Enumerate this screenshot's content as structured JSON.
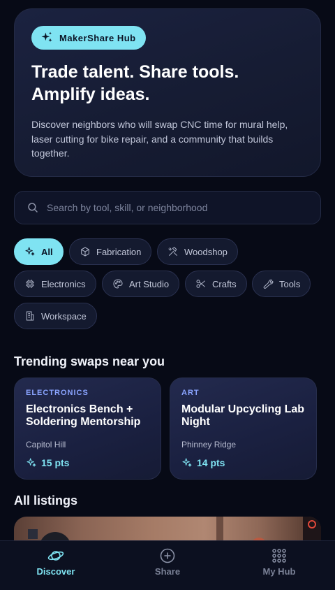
{
  "hero": {
    "brand": "MakerShare Hub",
    "title": "Trade talent. Share tools. Amplify ideas.",
    "description": "Discover neighbors who will swap CNC time for mural help, laser cutting for bike repair, and a community that builds together."
  },
  "search": {
    "placeholder": "Search by tool, skill, or neighborhood",
    "value": ""
  },
  "filters": [
    {
      "label": "All",
      "icon": "sparkles-icon",
      "active": true
    },
    {
      "label": "Fabrication",
      "icon": "box-icon",
      "active": false
    },
    {
      "label": "Woodshop",
      "icon": "hammer-wrench-icon",
      "active": false
    },
    {
      "label": "Electronics",
      "icon": "chip-icon",
      "active": false
    },
    {
      "label": "Art Studio",
      "icon": "palette-icon",
      "active": false
    },
    {
      "label": "Crafts",
      "icon": "scissors-icon",
      "active": false
    },
    {
      "label": "Tools",
      "icon": "wrench-icon",
      "active": false
    },
    {
      "label": "Workspace",
      "icon": "building-icon",
      "active": false
    }
  ],
  "trending": {
    "title": "Trending swaps near you",
    "cards": [
      {
        "category": "ELECTRONICS",
        "title": "Electronics Bench + Soldering Mentorship",
        "location": "Capitol Hill",
        "points": "15 pts"
      },
      {
        "category": "ART",
        "title": "Modular Upcycling Lab Night",
        "location": "Phinney Ridge",
        "points": "14 pts"
      }
    ]
  },
  "listings": {
    "title": "All listings"
  },
  "nav": {
    "items": [
      {
        "label": "Discover",
        "icon": "planet-icon",
        "active": true
      },
      {
        "label": "Share",
        "icon": "plus-circle-icon",
        "active": false
      },
      {
        "label": "My Hub",
        "icon": "grid-icon",
        "active": false
      }
    ]
  },
  "colors": {
    "accent": "#7fe3f2",
    "background": "#070a16",
    "card": "#1a2040",
    "category": "#8aa4ff"
  }
}
